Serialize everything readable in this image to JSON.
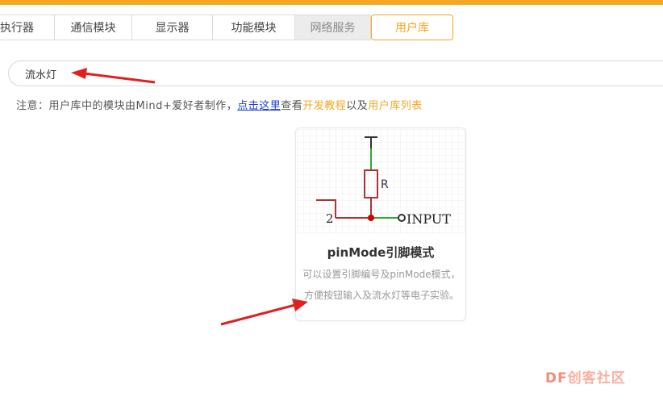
{
  "tabs": [
    {
      "label": "执行器"
    },
    {
      "label": "通信模块"
    },
    {
      "label": "显示器"
    },
    {
      "label": "功能模块"
    },
    {
      "label": "网络服务"
    },
    {
      "label": "用户库"
    }
  ],
  "search": {
    "value": "流水灯"
  },
  "notice": {
    "prefix": "注意：用户库中的模块由Mind+爱好者制作，",
    "link1": "点击这里",
    "mid1": "查看",
    "link2": "开发教程",
    "mid2": "以及",
    "link3": "用户库列表"
  },
  "card": {
    "title": "pinMode引脚模式",
    "desc": "可以设置引脚编号及pinMode模式，方便按钮输入及流水灯等电子实验。",
    "diagram_resistor_label": "R",
    "diagram_pin_label": "2",
    "diagram_input_label": "INPUT"
  },
  "watermark": {
    "df": "DF",
    "text": "创客社区"
  },
  "colors": {
    "accent": "#f5a623",
    "link": "#1a3fd6",
    "arrow": "#e02020"
  }
}
